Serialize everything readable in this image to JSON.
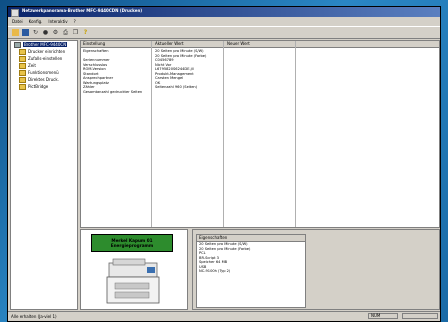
{
  "window": {
    "title": "Netzwerkpanorama-Brother MFC-9440CDN (Drucken)"
  },
  "menu": [
    "Datei",
    "Konfig.",
    "Interaktiv",
    "?"
  ],
  "tree": {
    "root": "Brother MFC-9440CN",
    "items": [
      "Drucker einrichten",
      "Zufalls-einstellen",
      "Zeit",
      "Funktionsmenü",
      "Direktes Druck.",
      "PictBridge"
    ]
  },
  "props": {
    "headers": [
      "Einstellung",
      "Aktueller Wert",
      "Neuer Wert"
    ],
    "rows": [
      {
        "name": "Eigenschaften",
        "value": "20 Seiten pro Minute (S/W)"
      },
      {
        "name": "",
        "value": "20 Seiten pro Minute (Farbe)"
      },
      {
        "name": "Seriennummer",
        "value": "C0456789"
      },
      {
        "name": "Verschlusslos",
        "value": "Nicht Vor"
      },
      {
        "name": "ROM-Version",
        "value": "L6795820S6244DE.jll"
      },
      {
        "name": "Standort",
        "value": "Produkt-Management"
      },
      {
        "name": "Ansprechpartner",
        "value": "Carsten Mengel"
      },
      {
        "name": "Wartungsplatz",
        "value": "OK"
      },
      {
        "name": "Zähler",
        "value": "Seitenzahl   960 (Seiten)"
      },
      {
        "name": "Gesamtanzahl gedruckter Seiten",
        "value": ""
      }
    ]
  },
  "banner": {
    "line1": "Merkel Kapum 01",
    "line2": "Energieprogramm"
  },
  "detail": {
    "header": "Eigenschaften",
    "lines": [
      "20 Seiten pro Minute (S/W)",
      "20 Seiten pro Minute (Farbe)",
      "PCL",
      "BR-Script 3",
      "Speicher 64 MB",
      "USB",
      "NC-9100h (Typ 2)"
    ]
  },
  "status": {
    "text": "Alle erhalten (Ja-viel 1)",
    "ind1": "NUM",
    "ind2": ""
  }
}
